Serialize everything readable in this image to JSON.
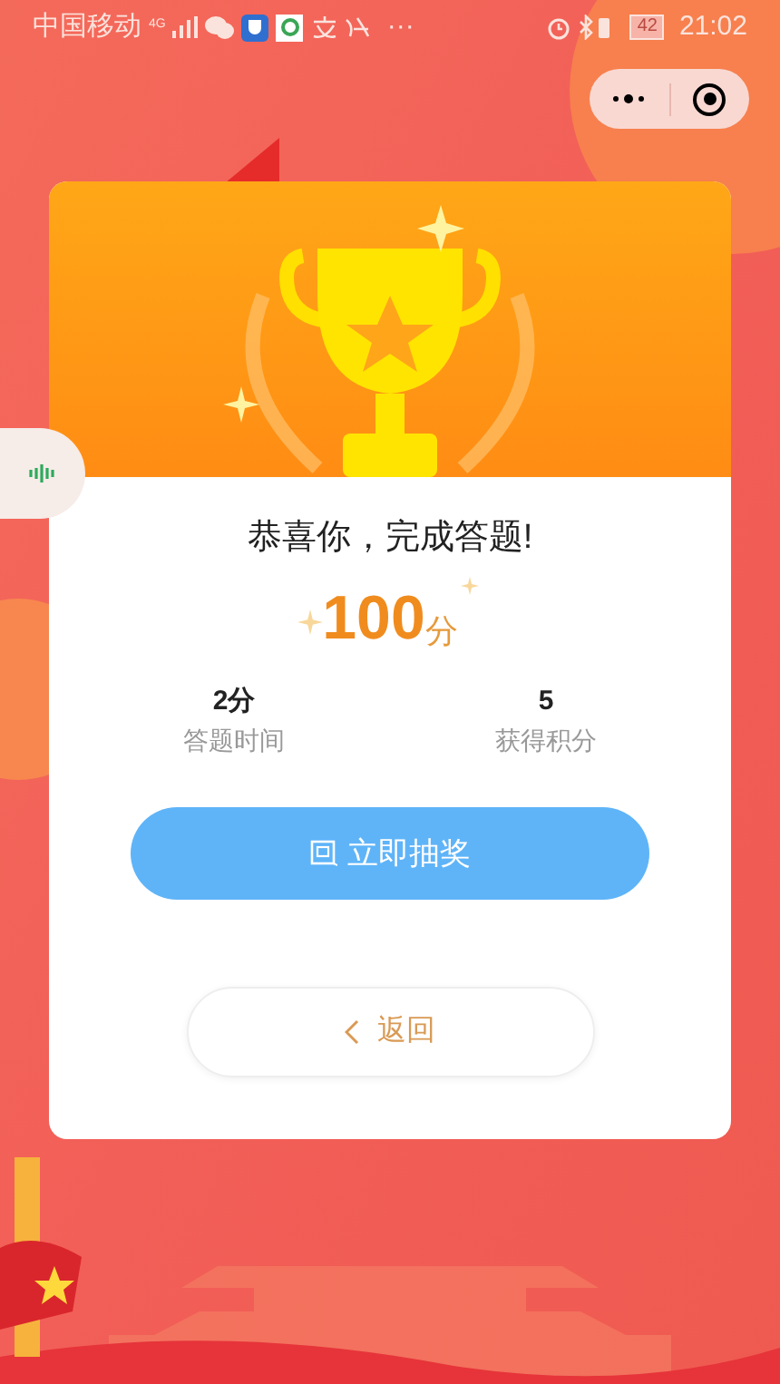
{
  "status_bar": {
    "carrier": "中国移动",
    "network": "4G",
    "more": "···",
    "battery": "42",
    "time": "21:02"
  },
  "result": {
    "title": "恭喜你，完成答题!",
    "score": "100",
    "unit": "分"
  },
  "stats": [
    {
      "value": "2分",
      "label": "答题时间"
    },
    {
      "value": "5",
      "label": "获得积分"
    }
  ],
  "draw_button": {
    "label": "立即抽奖"
  },
  "back_button": {
    "label": "返回"
  }
}
